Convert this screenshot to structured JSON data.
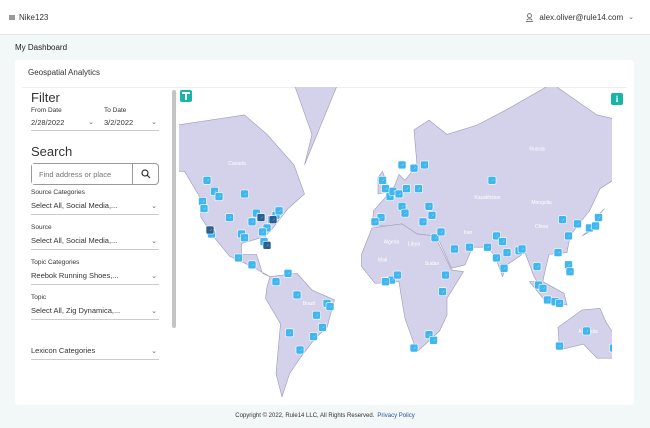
{
  "header": {
    "org": "Nike123",
    "user_email": "alex.oliver@rule14.com"
  },
  "breadcrumb": "My Dashboard",
  "card": {
    "title": "Geospatial Analytics"
  },
  "filter": {
    "heading": "Filter",
    "from_label": "From Date",
    "from_value": "2/28/2022",
    "to_label": "To Date",
    "to_value": "3/2/2022",
    "search_heading": "Search",
    "search_placeholder": "Find address or place",
    "fields": [
      {
        "label": "Source Categories",
        "value": "Select All, Social Media,..."
      },
      {
        "label": "Source",
        "value": "Select All, Social Media,..."
      },
      {
        "label": "Topic Categories",
        "value": "Reebok Running Shoes,..."
      },
      {
        "label": "Topic",
        "value": "Select All, Zig Dynamica,..."
      },
      {
        "label": "",
        "value": "Lexicon Categories"
      }
    ]
  },
  "map": {
    "land_color": "#d4d1ea",
    "marker_color": "#3fb6ef",
    "cluster_color": "#2a5f8f",
    "accent": "#19b5a8",
    "labels": [
      {
        "t": "Canada",
        "lon": -100,
        "lat": 60
      },
      {
        "t": "Russia",
        "lon": 100,
        "lat": 64
      },
      {
        "t": "Kazakhstan",
        "lon": 67,
        "lat": 48
      },
      {
        "t": "Mongolia",
        "lon": 103,
        "lat": 46
      },
      {
        "t": "China",
        "lon": 103,
        "lat": 35
      },
      {
        "t": "Iran",
        "lon": 54,
        "lat": 32
      },
      {
        "t": "Algeria",
        "lon": 3,
        "lat": 27
      },
      {
        "t": "Libya",
        "lon": 18,
        "lat": 26
      },
      {
        "t": "Sudan",
        "lon": 30,
        "lat": 15
      },
      {
        "t": "Mali",
        "lon": -3,
        "lat": 17
      },
      {
        "t": "Brazil",
        "lon": -52,
        "lat": -9
      },
      {
        "t": "Australia",
        "lon": 134,
        "lat": -25
      }
    ],
    "markers": [
      [
        -120,
        55
      ],
      [
        -115,
        51
      ],
      [
        -112,
        49
      ],
      [
        -123,
        47
      ],
      [
        -122,
        44
      ],
      [
        -95,
        50
      ],
      [
        -118,
        34
      ],
      [
        -117,
        32
      ],
      [
        -105,
        40
      ],
      [
        -97,
        32
      ],
      [
        -95,
        30
      ],
      [
        -90,
        38
      ],
      [
        -87,
        42
      ],
      [
        -84,
        40
      ],
      [
        -80,
        35
      ],
      [
        -83,
        33
      ],
      [
        -77,
        39
      ],
      [
        -74,
        41
      ],
      [
        -72,
        43
      ],
      [
        -80,
        26
      ],
      [
        -82,
        28
      ],
      [
        -99,
        19
      ],
      [
        -90,
        15
      ],
      [
        -74,
        5
      ],
      [
        -66,
        10
      ],
      [
        -47,
        -15
      ],
      [
        -43,
        -22
      ],
      [
        -40,
        -8
      ],
      [
        -60,
        -3
      ],
      [
        -58,
        -34
      ],
      [
        -65,
        -25
      ],
      [
        -49,
        -27
      ],
      [
        -38,
        -10
      ],
      [
        -3,
        55
      ],
      [
        -1,
        52
      ],
      [
        2,
        49
      ],
      [
        4,
        51
      ],
      [
        8,
        50
      ],
      [
        13,
        52
      ],
      [
        10,
        45
      ],
      [
        12,
        42
      ],
      [
        -4,
        40
      ],
      [
        -8,
        38
      ],
      [
        18,
        59
      ],
      [
        25,
        60
      ],
      [
        10,
        60
      ],
      [
        21,
        52
      ],
      [
        28,
        45
      ],
      [
        24,
        38
      ],
      [
        30,
        41
      ],
      [
        32,
        30
      ],
      [
        36,
        33
      ],
      [
        3,
        6
      ],
      [
        7,
        9
      ],
      [
        -1,
        5
      ],
      [
        37,
        -1
      ],
      [
        39,
        9
      ],
      [
        28,
        -26
      ],
      [
        31,
        -29
      ],
      [
        18,
        -33
      ],
      [
        45,
        24
      ],
      [
        55,
        25
      ],
      [
        67,
        25
      ],
      [
        73,
        31
      ],
      [
        77,
        28
      ],
      [
        80,
        22
      ],
      [
        73,
        19
      ],
      [
        78,
        13
      ],
      [
        88,
        23
      ],
      [
        90,
        24
      ],
      [
        100,
        14
      ],
      [
        101,
        3
      ],
      [
        104,
        1
      ],
      [
        107,
        -6
      ],
      [
        112,
        -7
      ],
      [
        115,
        -8
      ],
      [
        121,
        15
      ],
      [
        122,
        11
      ],
      [
        114,
        22
      ],
      [
        121,
        31
      ],
      [
        117,
        39
      ],
      [
        127,
        37
      ],
      [
        135,
        35
      ],
      [
        139,
        36
      ],
      [
        141,
        40
      ],
      [
        70,
        55
      ],
      [
        115,
        -32
      ],
      [
        133,
        -24
      ],
      [
        151,
        -33
      ],
      [
        153,
        -27
      ]
    ],
    "clusters": [
      [
        -118,
        34
      ],
      [
        -80,
        26
      ],
      [
        -76,
        39
      ],
      [
        -84,
        40
      ]
    ]
  },
  "footer": {
    "copyright": "Copyright © 2022, Rule14 LLC, All Rights Reserved.",
    "privacy": "Privacy Policy"
  }
}
